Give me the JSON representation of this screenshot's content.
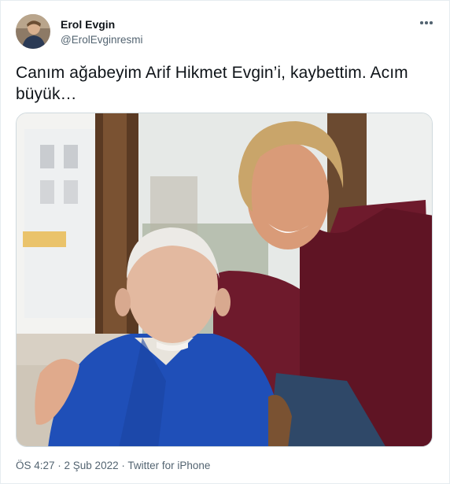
{
  "tweet": {
    "author_name": "Erol Evgin",
    "author_handle": "@ErolEvginresmi",
    "text": "Canım ağabeyim Arif Hikmet Evgin’i, kaybettim. Acım büyük…",
    "time": "ÖS 4:27",
    "separator": " · ",
    "date": "2 Şub 2022",
    "source": "Twitter for iPhone"
  },
  "icons": {
    "more": "more-dots-icon"
  },
  "colors": {
    "text_primary": "#0f1419",
    "text_secondary": "#536471",
    "border": "#cfd9de",
    "sweater": "#6e1a2c",
    "shirt": "#1f4fb8"
  }
}
